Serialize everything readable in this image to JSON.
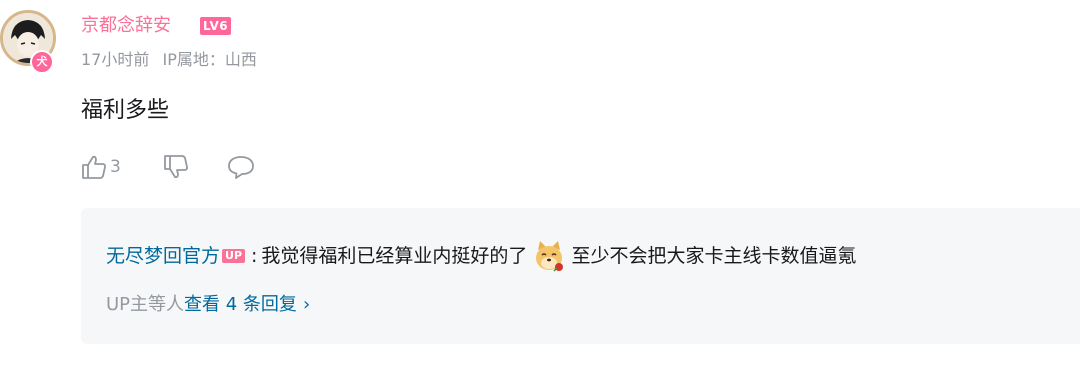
{
  "comment": {
    "username": "京都念辞安",
    "level": "LV6",
    "time": "17小时前",
    "ip_location": "IP属地：山西",
    "text": "福利多些",
    "like_count": "3",
    "avatar_badge_icon": "cat-badge-icon"
  },
  "reply_preview": {
    "user": "无尽梦回官方",
    "up_badge": "UP",
    "separator": ":",
    "text_before": "我觉得福利已经算业内挺好的了",
    "emoji": "doge-rose-emoji",
    "text_after": "至少不会把大家卡主线卡数值逼氪",
    "prefix": "UP主等人",
    "more_link": "查看 4 条回复",
    "chevron": "›"
  },
  "colors": {
    "username": "#fb7299",
    "link": "#00699d",
    "meta": "#9499a0",
    "panel_bg": "#f6f7f8"
  }
}
